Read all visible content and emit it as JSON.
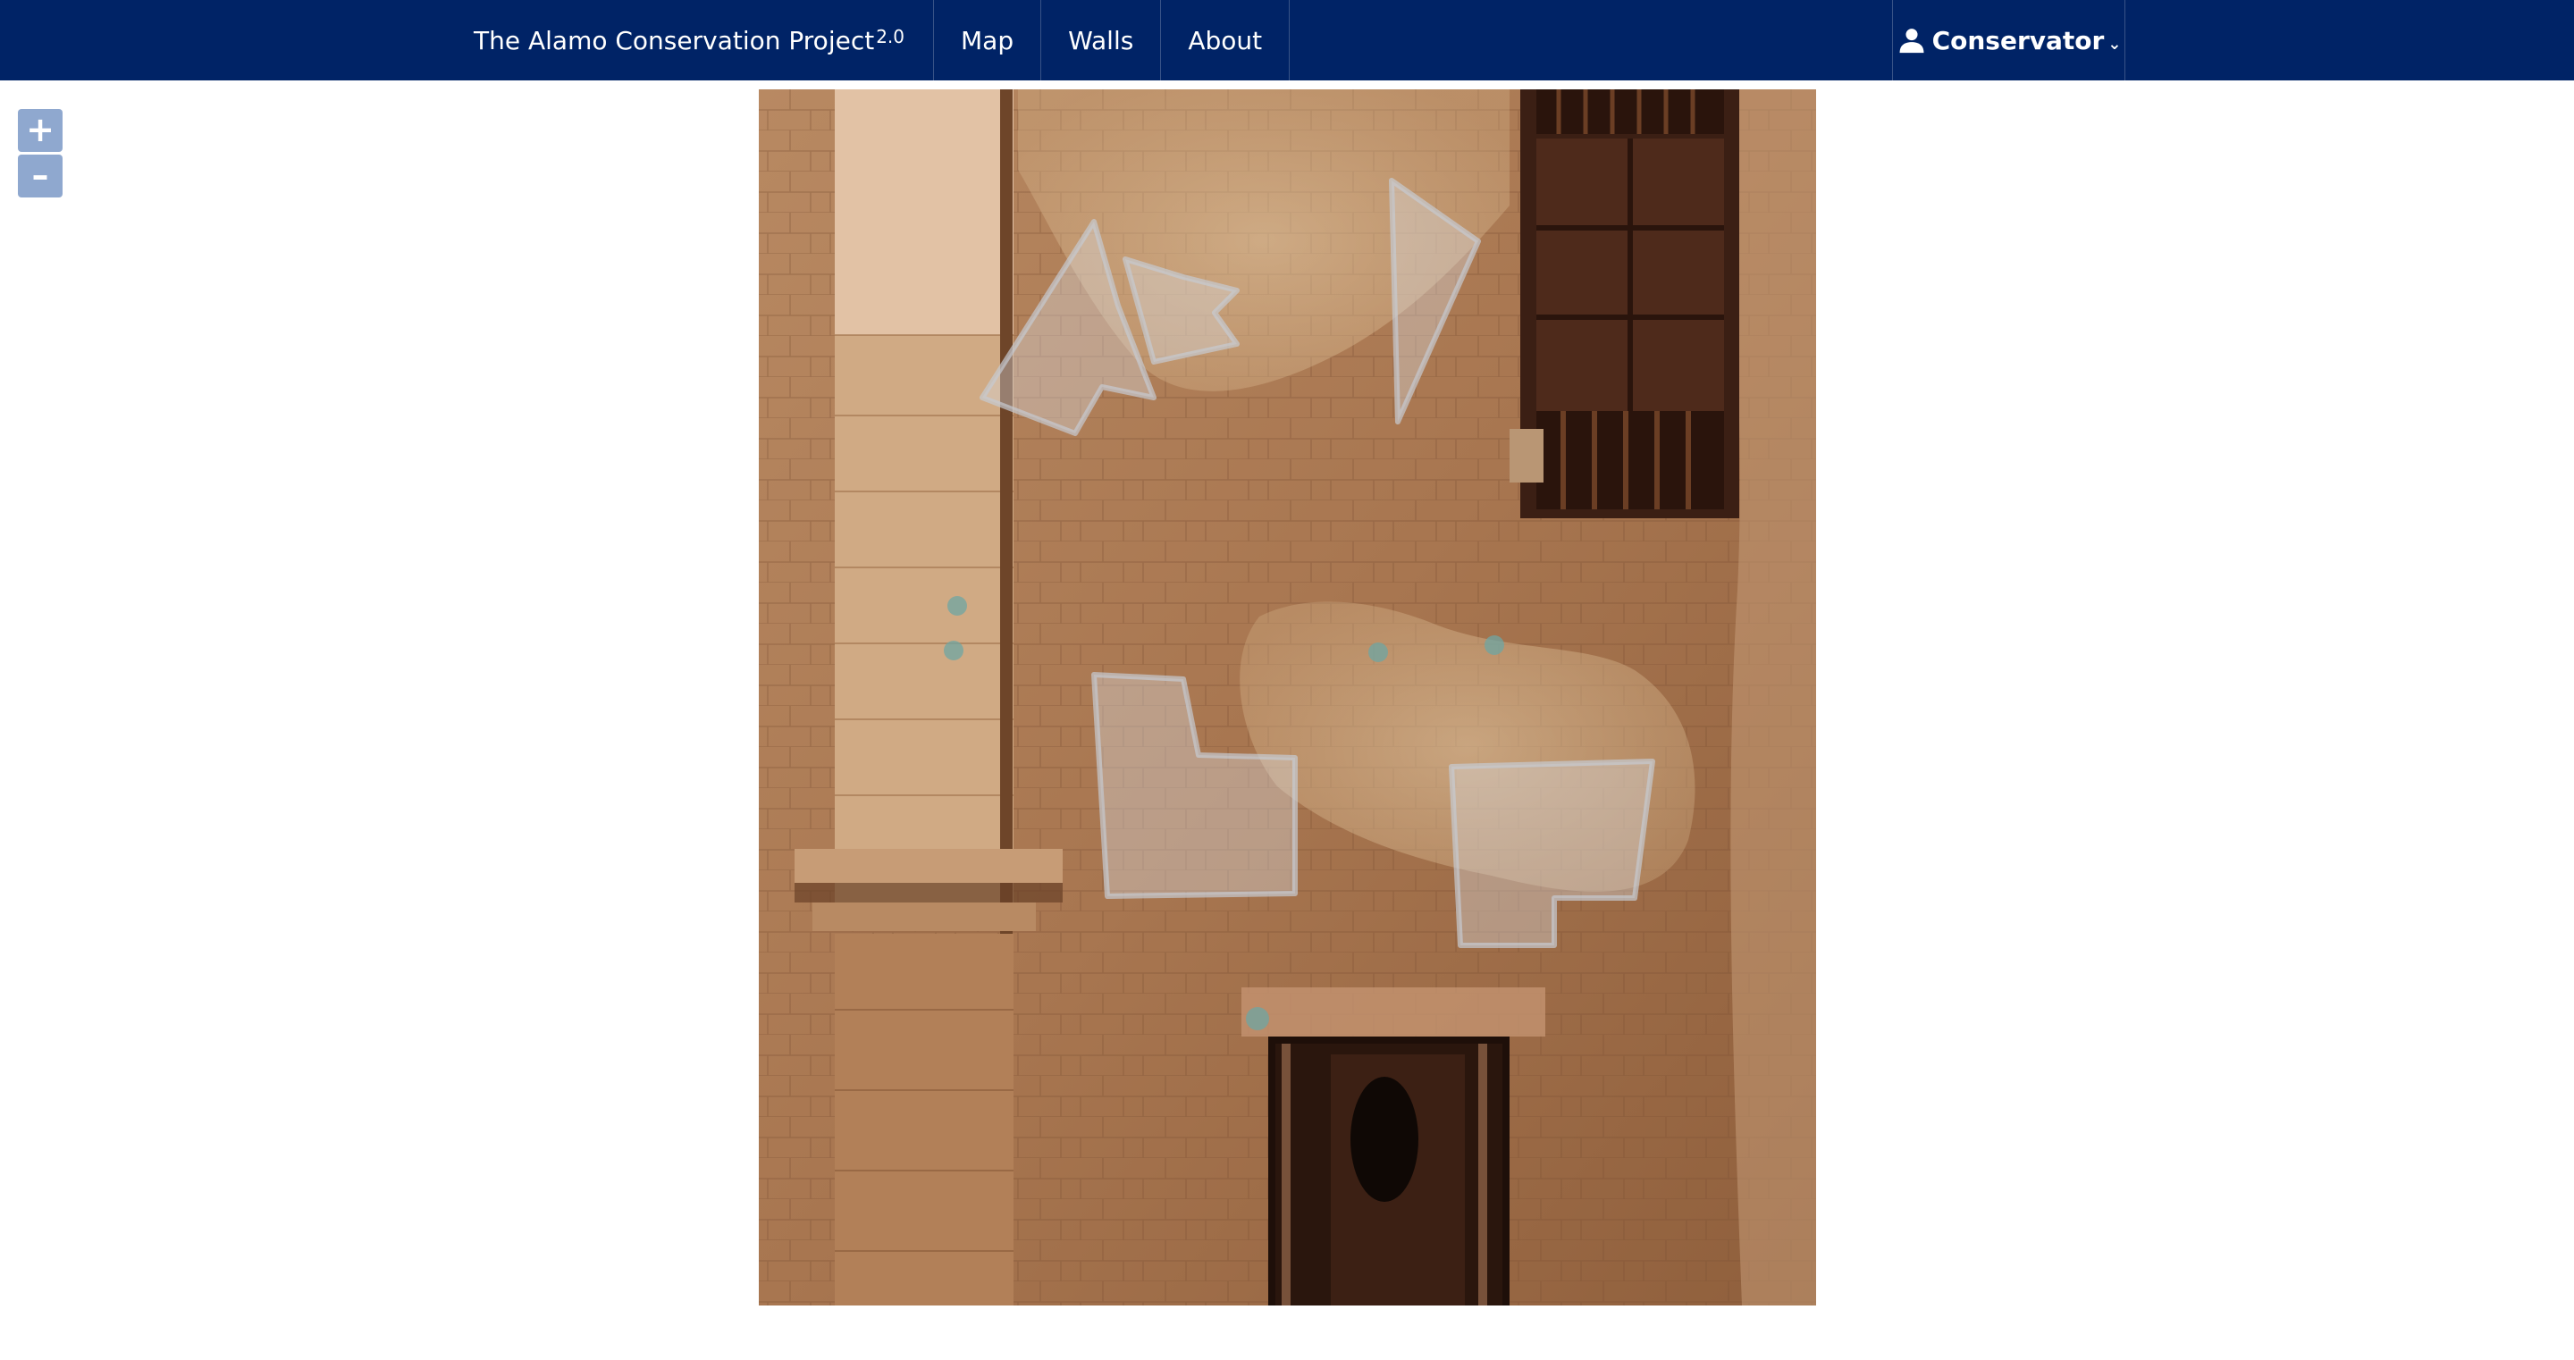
{
  "navbar": {
    "brand": "The Alamo Conservation Project",
    "brand_version": "2.0",
    "items": [
      {
        "label": "Map"
      },
      {
        "label": "Walls"
      },
      {
        "label": "About"
      }
    ],
    "user_menu": {
      "label": "Conservator",
      "icon": "user-icon",
      "caret": "⌄"
    }
  },
  "zoom": {
    "in_label": "+",
    "out_label": "–"
  },
  "viewer": {
    "image_subject": "Alamo stone wall elevation with window and doorway",
    "colors": {
      "navbar": "#002366",
      "zoom_button": "#8fa8cf",
      "annotation_fill": "#d9dde3",
      "marker_fill": "#6fa5a3"
    }
  }
}
